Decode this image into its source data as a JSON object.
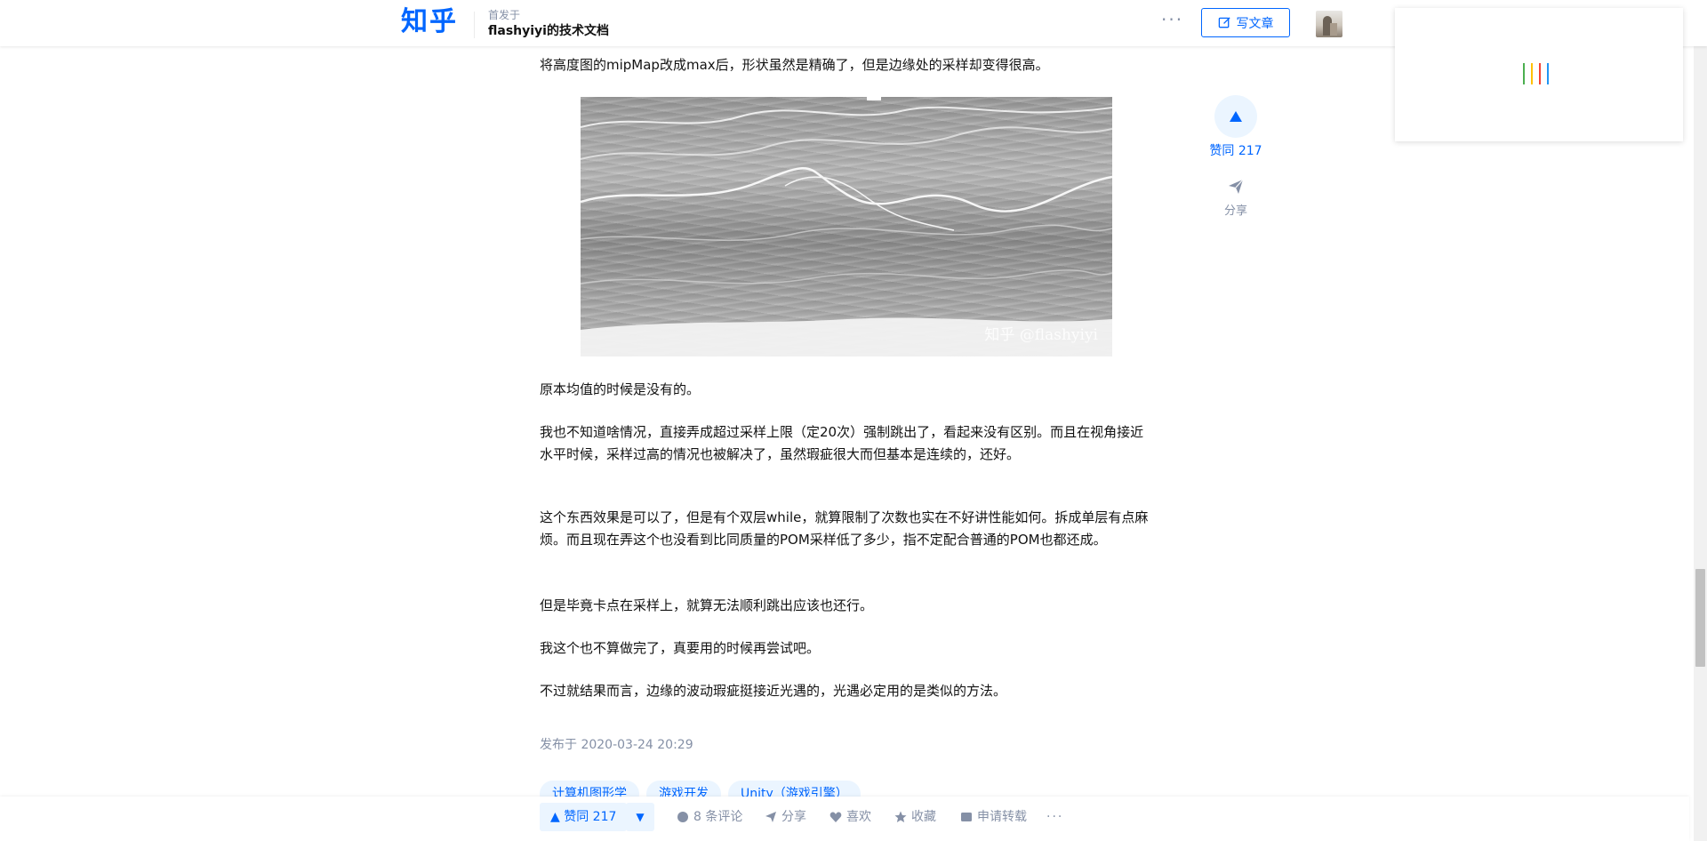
{
  "header": {
    "logo": "知乎",
    "published_in_label": "首发于",
    "column_name": "flashyiyi的技术文档",
    "more_label": "···",
    "write_button": "写文章"
  },
  "loader": {
    "bar_colors": [
      "#4caf50",
      "#ffc107",
      "#f44336",
      "#2196f3"
    ]
  },
  "article": {
    "p1": "将高度图的mipMap改成max后，形状虽然是精确了，但是边缘处的采样却变得很高。",
    "image_watermark": "知乎 @flashyiyi",
    "p2": "原本均值的时候是没有的。",
    "p3": "我也不知道啥情况，直接弄成超过采样上限（定20次）强制跳出了，看起来没有区别。而且在视角接近水平时候，采样过高的情况也被解决了，虽然瑕疵很大而但基本是连续的，还好。",
    "p4": "这个东西效果是可以了，但是有个双层while，就算限制了次数也实在不好讲性能如何。拆成单层有点麻烦。而且现在弄这个也没看到比同质量的POM采样低了多少，指不定配合普通的POM也都还成。",
    "p5": "但是毕竟卡点在采样上，就算无法顺利跳出应该也还行。",
    "p6": "我这个也不算做完了，真要用的时候再尝试吧。",
    "p7": "不过就结果而言，边缘的波动瑕疵挺接近光遇的，光遇必定用的是类似的方法。",
    "publish_time": "发布于 2020-03-24 20:29",
    "tags": [
      "计算机图形学",
      "游戏开发",
      "Unity（游戏引擎）"
    ]
  },
  "side": {
    "vote_label": "赞同 217",
    "share_label": "分享"
  },
  "action_bar": {
    "vote_up": "▲ 赞同 217",
    "vote_down": "▼",
    "comments": "8 条评论",
    "share": "分享",
    "like": "喜欢",
    "collect": "收藏",
    "reprint": "申请转载",
    "more": "···"
  }
}
